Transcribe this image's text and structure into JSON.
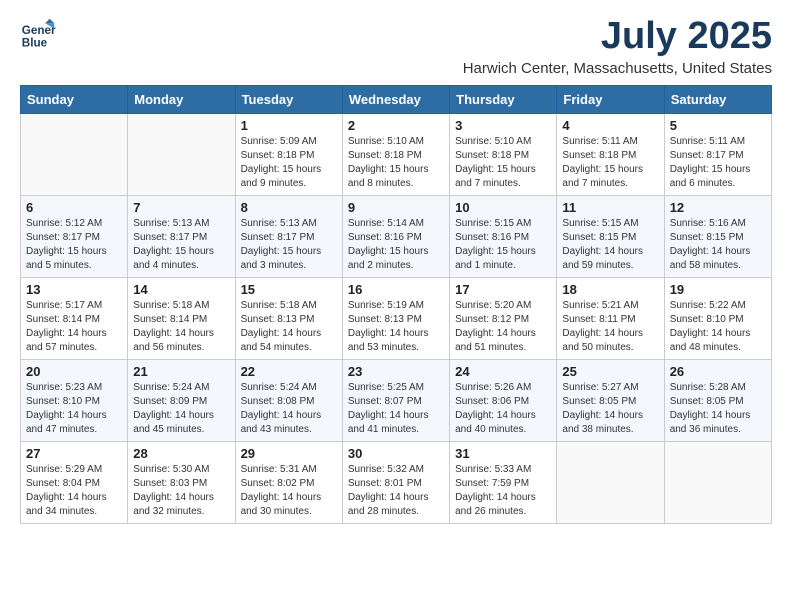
{
  "header": {
    "logo_line1": "General",
    "logo_line2": "Blue",
    "month_title": "July 2025",
    "location": "Harwich Center, Massachusetts, United States"
  },
  "weekdays": [
    "Sunday",
    "Monday",
    "Tuesday",
    "Wednesday",
    "Thursday",
    "Friday",
    "Saturday"
  ],
  "weeks": [
    [
      {
        "day": "",
        "empty": true
      },
      {
        "day": "",
        "empty": true
      },
      {
        "day": "1",
        "sunrise": "Sunrise: 5:09 AM",
        "sunset": "Sunset: 8:18 PM",
        "daylight": "Daylight: 15 hours and 9 minutes."
      },
      {
        "day": "2",
        "sunrise": "Sunrise: 5:10 AM",
        "sunset": "Sunset: 8:18 PM",
        "daylight": "Daylight: 15 hours and 8 minutes."
      },
      {
        "day": "3",
        "sunrise": "Sunrise: 5:10 AM",
        "sunset": "Sunset: 8:18 PM",
        "daylight": "Daylight: 15 hours and 7 minutes."
      },
      {
        "day": "4",
        "sunrise": "Sunrise: 5:11 AM",
        "sunset": "Sunset: 8:18 PM",
        "daylight": "Daylight: 15 hours and 7 minutes."
      },
      {
        "day": "5",
        "sunrise": "Sunrise: 5:11 AM",
        "sunset": "Sunset: 8:17 PM",
        "daylight": "Daylight: 15 hours and 6 minutes."
      }
    ],
    [
      {
        "day": "6",
        "sunrise": "Sunrise: 5:12 AM",
        "sunset": "Sunset: 8:17 PM",
        "daylight": "Daylight: 15 hours and 5 minutes."
      },
      {
        "day": "7",
        "sunrise": "Sunrise: 5:13 AM",
        "sunset": "Sunset: 8:17 PM",
        "daylight": "Daylight: 15 hours and 4 minutes."
      },
      {
        "day": "8",
        "sunrise": "Sunrise: 5:13 AM",
        "sunset": "Sunset: 8:17 PM",
        "daylight": "Daylight: 15 hours and 3 minutes."
      },
      {
        "day": "9",
        "sunrise": "Sunrise: 5:14 AM",
        "sunset": "Sunset: 8:16 PM",
        "daylight": "Daylight: 15 hours and 2 minutes."
      },
      {
        "day": "10",
        "sunrise": "Sunrise: 5:15 AM",
        "sunset": "Sunset: 8:16 PM",
        "daylight": "Daylight: 15 hours and 1 minute."
      },
      {
        "day": "11",
        "sunrise": "Sunrise: 5:15 AM",
        "sunset": "Sunset: 8:15 PM",
        "daylight": "Daylight: 14 hours and 59 minutes."
      },
      {
        "day": "12",
        "sunrise": "Sunrise: 5:16 AM",
        "sunset": "Sunset: 8:15 PM",
        "daylight": "Daylight: 14 hours and 58 minutes."
      }
    ],
    [
      {
        "day": "13",
        "sunrise": "Sunrise: 5:17 AM",
        "sunset": "Sunset: 8:14 PM",
        "daylight": "Daylight: 14 hours and 57 minutes."
      },
      {
        "day": "14",
        "sunrise": "Sunrise: 5:18 AM",
        "sunset": "Sunset: 8:14 PM",
        "daylight": "Daylight: 14 hours and 56 minutes."
      },
      {
        "day": "15",
        "sunrise": "Sunrise: 5:18 AM",
        "sunset": "Sunset: 8:13 PM",
        "daylight": "Daylight: 14 hours and 54 minutes."
      },
      {
        "day": "16",
        "sunrise": "Sunrise: 5:19 AM",
        "sunset": "Sunset: 8:13 PM",
        "daylight": "Daylight: 14 hours and 53 minutes."
      },
      {
        "day": "17",
        "sunrise": "Sunrise: 5:20 AM",
        "sunset": "Sunset: 8:12 PM",
        "daylight": "Daylight: 14 hours and 51 minutes."
      },
      {
        "day": "18",
        "sunrise": "Sunrise: 5:21 AM",
        "sunset": "Sunset: 8:11 PM",
        "daylight": "Daylight: 14 hours and 50 minutes."
      },
      {
        "day": "19",
        "sunrise": "Sunrise: 5:22 AM",
        "sunset": "Sunset: 8:10 PM",
        "daylight": "Daylight: 14 hours and 48 minutes."
      }
    ],
    [
      {
        "day": "20",
        "sunrise": "Sunrise: 5:23 AM",
        "sunset": "Sunset: 8:10 PM",
        "daylight": "Daylight: 14 hours and 47 minutes."
      },
      {
        "day": "21",
        "sunrise": "Sunrise: 5:24 AM",
        "sunset": "Sunset: 8:09 PM",
        "daylight": "Daylight: 14 hours and 45 minutes."
      },
      {
        "day": "22",
        "sunrise": "Sunrise: 5:24 AM",
        "sunset": "Sunset: 8:08 PM",
        "daylight": "Daylight: 14 hours and 43 minutes."
      },
      {
        "day": "23",
        "sunrise": "Sunrise: 5:25 AM",
        "sunset": "Sunset: 8:07 PM",
        "daylight": "Daylight: 14 hours and 41 minutes."
      },
      {
        "day": "24",
        "sunrise": "Sunrise: 5:26 AM",
        "sunset": "Sunset: 8:06 PM",
        "daylight": "Daylight: 14 hours and 40 minutes."
      },
      {
        "day": "25",
        "sunrise": "Sunrise: 5:27 AM",
        "sunset": "Sunset: 8:05 PM",
        "daylight": "Daylight: 14 hours and 38 minutes."
      },
      {
        "day": "26",
        "sunrise": "Sunrise: 5:28 AM",
        "sunset": "Sunset: 8:05 PM",
        "daylight": "Daylight: 14 hours and 36 minutes."
      }
    ],
    [
      {
        "day": "27",
        "sunrise": "Sunrise: 5:29 AM",
        "sunset": "Sunset: 8:04 PM",
        "daylight": "Daylight: 14 hours and 34 minutes."
      },
      {
        "day": "28",
        "sunrise": "Sunrise: 5:30 AM",
        "sunset": "Sunset: 8:03 PM",
        "daylight": "Daylight: 14 hours and 32 minutes."
      },
      {
        "day": "29",
        "sunrise": "Sunrise: 5:31 AM",
        "sunset": "Sunset: 8:02 PM",
        "daylight": "Daylight: 14 hours and 30 minutes."
      },
      {
        "day": "30",
        "sunrise": "Sunrise: 5:32 AM",
        "sunset": "Sunset: 8:01 PM",
        "daylight": "Daylight: 14 hours and 28 minutes."
      },
      {
        "day": "31",
        "sunrise": "Sunrise: 5:33 AM",
        "sunset": "Sunset: 7:59 PM",
        "daylight": "Daylight: 14 hours and 26 minutes."
      },
      {
        "day": "",
        "empty": true
      },
      {
        "day": "",
        "empty": true
      }
    ]
  ]
}
